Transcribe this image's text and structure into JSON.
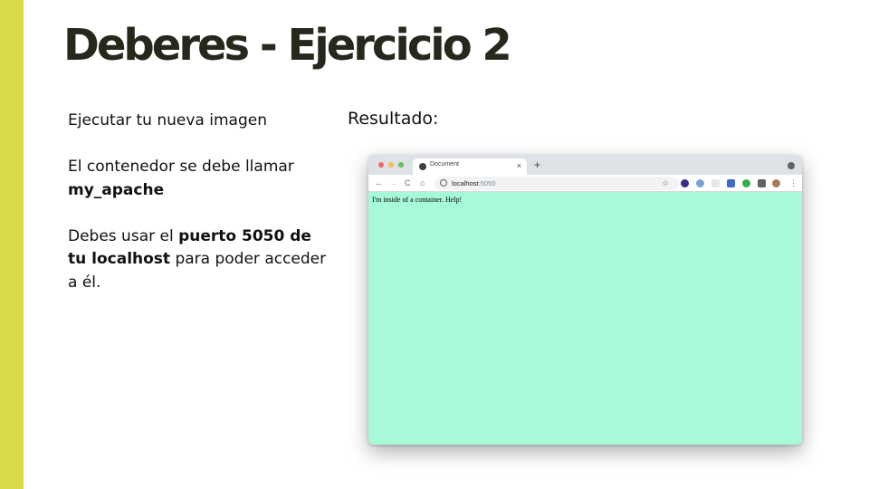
{
  "slide": {
    "title": "Deberes - Ejercicio 2",
    "instructions": {
      "line1": "Ejecutar tu nueva imagen",
      "line2_prefix": "El contenedor se debe llamar ",
      "line2_bold": "my_apache",
      "line3_prefix": "Debes usar el ",
      "line3_bold": "puerto 5050 de tu localhost",
      "line3_suffix": " para poder acceder a él."
    },
    "result_label": "Resultado:"
  },
  "browser": {
    "tab_title": "Document",
    "tab_close": "×",
    "new_tab": "+",
    "nav": {
      "back": "←",
      "forward": "→",
      "reload": "C",
      "home": "⌂"
    },
    "url_host": "localhost",
    "url_port": ":5050",
    "bookmark_star": "☆",
    "menu": "⋮",
    "page_text": "I'm inside of a container. Help!",
    "page_background": "#a7fad8",
    "extension_icons": [
      "extension-icon",
      "extension-icon",
      "extension-icon",
      "extension-icon",
      "extension-icon",
      "puzzle-icon",
      "avatar"
    ]
  },
  "colors": {
    "accent": "#d9da47",
    "title": "#26281c"
  }
}
